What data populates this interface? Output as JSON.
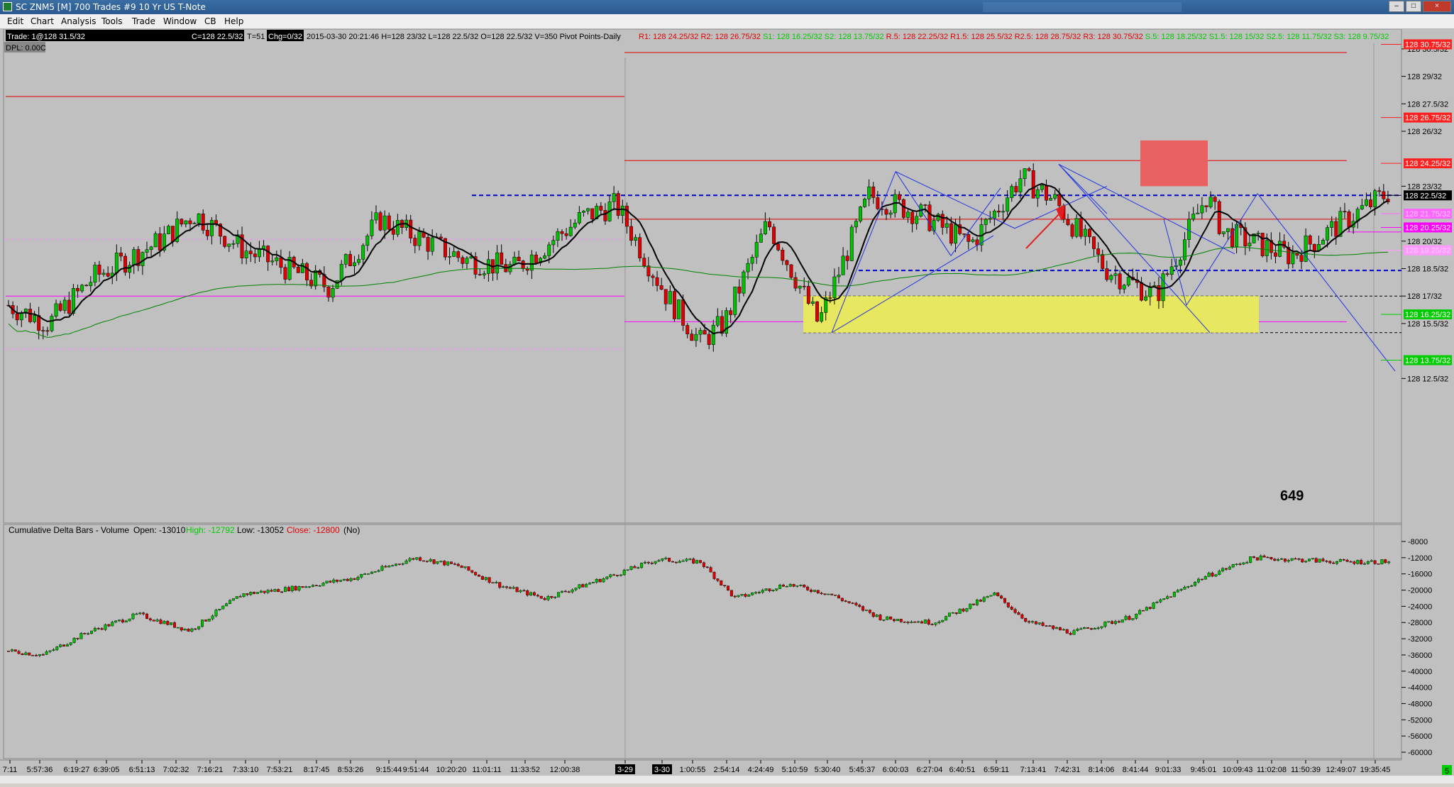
{
  "window": {
    "title": "SC ZNM5 [M]  700 Trades  #9  10 Yr US T-Note",
    "minimize": "–",
    "maximize": "□",
    "close": "×"
  },
  "menu": [
    "Edit",
    "Chart",
    "Analysis",
    "Tools",
    "Trade",
    "Window",
    "CB",
    "Help"
  ],
  "info": {
    "trade": "Trade: 1@128 31.5/32",
    "symbol": "ZNM5 [M]  700 Trades  #9",
    "close": "C=128 22.5/32",
    "ticks": "T=51",
    "change": "Chg=0/32",
    "bar_info": "2015-03-30 20:21:46 H=128 23/32 L=128 22.5/32 O=128 22.5/32 V=350 Pivot Points-Daily",
    "dpl": "DPL: 0.00C"
  },
  "pivots": [
    {
      "label": "R1: 128 24.25/32",
      "color": "#e00000"
    },
    {
      "label": "R2: 128 26.75/32",
      "color": "#e00000"
    },
    {
      "label": "S1: 128 16.25/32",
      "color": "#00cc00"
    },
    {
      "label": "S2: 128 13.75/32",
      "color": "#00cc00"
    },
    {
      "label": "R.5: 128 22.25/32",
      "color": "#e00000"
    },
    {
      "label": "R1.5: 128 25.5/32",
      "color": "#e00000"
    },
    {
      "label": "R2.5: 128 28.75/32",
      "color": "#e00000"
    },
    {
      "label": "R3: 128 30.75/32",
      "color": "#e00000"
    },
    {
      "label": "S.5: 128 18.25/32",
      "color": "#00cc00"
    },
    {
      "label": "S1.5: 128 15/32",
      "color": "#00cc00"
    },
    {
      "label": "S2.5: 128 11.75/32",
      "color": "#00cc00"
    },
    {
      "label": "S3: 128 9.75/32",
      "color": "#00cc00"
    }
  ],
  "price_axis": {
    "ticks": [
      {
        "label": "128 30.5/32",
        "y": 30.5
      },
      {
        "label": "128 29/32",
        "y": 29
      },
      {
        "label": "128 27.5/32",
        "y": 27.5
      },
      {
        "label": "128 26/32",
        "y": 26
      },
      {
        "label": "128 23/32",
        "y": 23
      },
      {
        "label": "128 20/32",
        "y": 20
      },
      {
        "label": "128 18.5/32",
        "y": 18.5
      },
      {
        "label": "128 17/32",
        "y": 17
      },
      {
        "label": "128 15.5/32",
        "y": 15.5
      },
      {
        "label": "128 12.5/32",
        "y": 12.5
      }
    ],
    "badges": [
      {
        "label": "128 30.75/32",
        "y": 30.75,
        "bg": "#ff2020",
        "fg": "#ffffff"
      },
      {
        "label": "128 26.75/32",
        "y": 26.75,
        "bg": "#ff2020",
        "fg": "#ffffff"
      },
      {
        "label": "128 24.25/32",
        "y": 24.25,
        "bg": "#ff2020",
        "fg": "#ffffff"
      },
      {
        "label": "128 22.5/32",
        "y": 22.5,
        "bg": "#000000",
        "fg": "#ffffff"
      },
      {
        "label": "128 21.75/32",
        "y": 21.5,
        "bg": "#ff66ff",
        "fg": "#ffccff"
      },
      {
        "label": "128 20.25/32",
        "y": 20.75,
        "bg": "#ff00ff",
        "fg": "#ffffff"
      },
      {
        "label": "128 19.25/32",
        "y": 19.5,
        "bg": "#ff99ff",
        "fg": "#ffd0ff"
      },
      {
        "label": "128 16.25/32",
        "y": 16.0,
        "bg": "#00cc00",
        "fg": "#ffffff"
      },
      {
        "label": "128 13.75/32",
        "y": 13.5,
        "bg": "#00cc00",
        "fg": "#ffffff"
      }
    ]
  },
  "annotation": "649",
  "study": {
    "name": "Cumulative Delta Bars - Volume",
    "open": "Open: -13010",
    "high": "High: -12792",
    "low": "Low: -13052",
    "close": "Close: -12800",
    "flag": "(No)",
    "ticks": [
      {
        "label": "-8000",
        "v": -8000
      },
      {
        "label": "-12000",
        "v": -12000
      },
      {
        "label": "-16000",
        "v": -16000
      },
      {
        "label": "-20000",
        "v": -20000
      },
      {
        "label": "-24000",
        "v": -24000
      },
      {
        "label": "-28000",
        "v": -28000
      },
      {
        "label": "-32000",
        "v": -32000
      },
      {
        "label": "-36000",
        "v": -36000
      },
      {
        "label": "-40000",
        "v": -40000
      },
      {
        "label": "-44000",
        "v": -44000
      },
      {
        "label": "-48000",
        "v": -48000
      },
      {
        "label": "-52000",
        "v": -52000
      },
      {
        "label": "-56000",
        "v": -56000
      },
      {
        "label": "-60000",
        "v": -60000
      }
    ],
    "corner": "5"
  },
  "time_axis": [
    {
      "label": "7:11",
      "hl": false
    },
    {
      "label": "5:57:36",
      "hl": false
    },
    {
      "label": "6:19:27",
      "hl": false
    },
    {
      "label": "6:39:05",
      "hl": false
    },
    {
      "label": "6:51:13",
      "hl": false
    },
    {
      "label": "7:02:32",
      "hl": false
    },
    {
      "label": "7:16:21",
      "hl": false
    },
    {
      "label": "7:33:10",
      "hl": false
    },
    {
      "label": "7:53:21",
      "hl": false
    },
    {
      "label": "8:17:45",
      "hl": false
    },
    {
      "label": "8:53:26",
      "hl": false
    },
    {
      "label": "9:15:44",
      "hl": false
    },
    {
      "label": "9:51:44",
      "hl": false
    },
    {
      "label": "10:20:20",
      "hl": false
    },
    {
      "label": "11:01:11",
      "hl": false
    },
    {
      "label": "11:33:52",
      "hl": false
    },
    {
      "label": "12:00:38",
      "hl": false
    },
    {
      "label": "3-29",
      "hl": true
    },
    {
      "label": "3-30",
      "hl": true
    },
    {
      "label": "1:00:55",
      "hl": false
    },
    {
      "label": "2:54:14",
      "hl": false
    },
    {
      "label": "4:24:49",
      "hl": false
    },
    {
      "label": "5:10:59",
      "hl": false
    },
    {
      "label": "5:30:40",
      "hl": false
    },
    {
      "label": "5:45:37",
      "hl": false
    },
    {
      "label": "6:00:03",
      "hl": false
    },
    {
      "label": "6:27:04",
      "hl": false
    },
    {
      "label": "6:40:51",
      "hl": false
    },
    {
      "label": "6:59:11",
      "hl": false
    },
    {
      "label": "7:13:41",
      "hl": false
    },
    {
      "label": "7:42:31",
      "hl": false
    },
    {
      "label": "8:14:06",
      "hl": false
    },
    {
      "label": "8:41:44",
      "hl": false
    },
    {
      "label": "9:01:33",
      "hl": false
    },
    {
      "label": "9:45:01",
      "hl": false
    },
    {
      "label": "10:09:43",
      "hl": false
    },
    {
      "label": "11:02:08",
      "hl": false
    },
    {
      "label": "11:50:39",
      "hl": false
    },
    {
      "label": "12:49:07",
      "hl": false
    },
    {
      "label": "19:35:45",
      "hl": false
    }
  ],
  "colors": {
    "chart_bg": "#c0c0c0",
    "up_bar": "#00c000",
    "down_bar": "#e00000",
    "ma_fast": "#000000",
    "ma_slow": "#008000",
    "pivot_line": "#e00000",
    "pink_line": "#ff00ff",
    "blue_dash": "#0000cc",
    "zone": "#e8e860",
    "red_box": "#e86060"
  }
}
